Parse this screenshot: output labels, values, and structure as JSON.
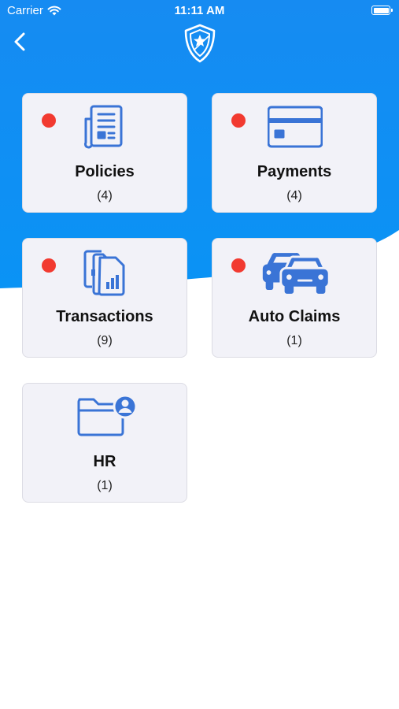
{
  "status_bar": {
    "carrier": "Carrier",
    "time": "11:11 AM"
  },
  "header": {
    "back_icon": "chevron-left-icon",
    "logo_icon": "shield-star-logo"
  },
  "colors": {
    "brand_blue": "#1a8cf0",
    "badge_red": "#f23a30",
    "icon_blue": "#3a74d6"
  },
  "cards": [
    {
      "label": "Policies",
      "count": "(4)",
      "icon": "document-icon",
      "has_badge": true
    },
    {
      "label": "Payments",
      "count": "(4)",
      "icon": "credit-card-icon",
      "has_badge": true
    },
    {
      "label": "Transactions",
      "count": "(9)",
      "icon": "transactions-icon",
      "has_badge": true
    },
    {
      "label": "Auto Claims",
      "count": "(1)",
      "icon": "cars-icon",
      "has_badge": true
    },
    {
      "label": "HR",
      "count": "(1)",
      "icon": "folder-user-icon",
      "has_badge": false
    }
  ]
}
